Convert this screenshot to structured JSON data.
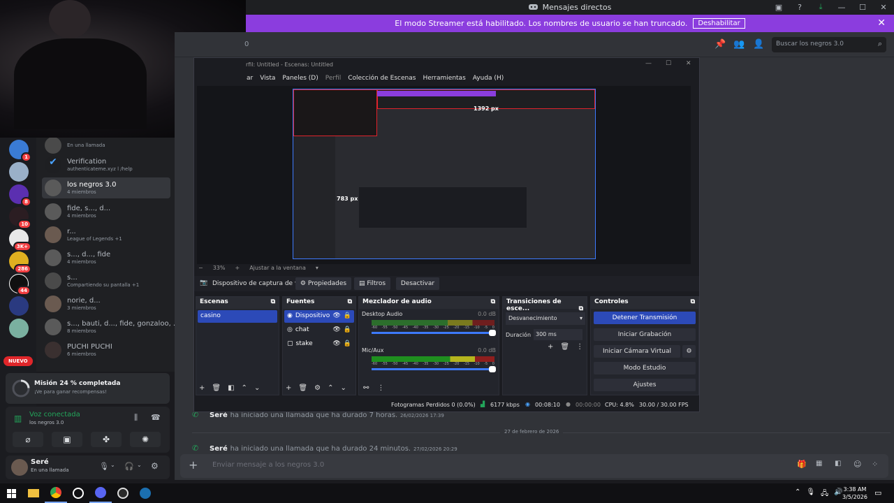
{
  "topbar": {
    "title": "Mensajes directos"
  },
  "streamer_banner": {
    "text": "El modo Streamer está habilitado. Los nombres de usuario se han truncado.",
    "button": "Deshabilitar"
  },
  "chat_header": {
    "search_placeholder": "Buscar los negros 3.0"
  },
  "server_badges": [
    "1",
    "8",
    "10",
    "3K+",
    "286",
    "44"
  ],
  "nuevo": "NUEVO",
  "dm_list": [
    {
      "name": "",
      "status": "En una llamada"
    },
    {
      "name": "Verification",
      "status": "authenticateme.xyz l /help"
    },
    {
      "name": "los negros 3.0",
      "status": "4 miembros"
    },
    {
      "name": "fide, s..., d...",
      "status": "4 miembros"
    },
    {
      "name": "r...",
      "status": "League of Legends +1"
    },
    {
      "name": "s..., d..., fide",
      "status": "4 miembros"
    },
    {
      "name": "s...",
      "status": "Compartiendo su pantalla +1"
    },
    {
      "name": "norie, d...",
      "status": "3 miembros"
    },
    {
      "name": "s..., bauti, d..., fide, gonzaloo, ...",
      "status": "8 miembros"
    },
    {
      "name": "PUCHI PUCHI",
      "status": "6 miembros"
    }
  ],
  "mission": {
    "title": "Misión 24 % completada",
    "sub": "¡Ve para ganar recompensas!",
    "progress": 0.24
  },
  "voice": {
    "status": "Voz conectada",
    "channel": "los negros 3.0"
  },
  "user": {
    "name": "Seré",
    "status": "En una llamada"
  },
  "obs": {
    "title": "rfil: Untitled - Escenas: Untitled",
    "menu": [
      "ar",
      "Vista",
      "Paneles (D)",
      "Perfil",
      "Colección de Escenas",
      "Herramientas",
      "Ayuda (H)"
    ],
    "dims": {
      "w": "1392 px",
      "h": "783 px"
    },
    "zoom": "33%",
    "fit": "Ajustar a la ventana",
    "source_bar": {
      "name": "Dispositivo de captura de v",
      "props": "Propiedades",
      "filters": "Filtros",
      "deactivate": "Desactivar"
    },
    "scenes_title": "Escenas",
    "scenes": [
      "casino"
    ],
    "sources_title": "Fuentes",
    "sources": [
      "Dispositivo",
      "chat",
      "stake"
    ],
    "mixer_title": "Mezclador de audio",
    "mixer": [
      {
        "name": "Desktop Audio",
        "db": "0.0 dB"
      },
      {
        "name": "Mic/Aux",
        "db": "0.0 dB"
      }
    ],
    "mixer_ticks": [
      "-60",
      "-55",
      "-50",
      "-45",
      "-40",
      "-35",
      "-30",
      "-25",
      "-20",
      "-15",
      "-10",
      "-5",
      "0"
    ],
    "transitions_title": "Transiciones de esce...",
    "transition": "Desvanecimiento",
    "duration_label": "Duración",
    "duration": "300 ms",
    "controls_title": "Controles",
    "controls": [
      "Detener Transmisión",
      "Iniciar Grabación",
      "Iniciar Cámara Virtual",
      "Modo Estudio",
      "Ajustes"
    ],
    "status": {
      "dropped": "Fotogramas Perdidos 0 (0.0%)",
      "kbps": "6177 kbps",
      "stream_time": "00:08:10",
      "rec_time": "00:00:00",
      "cpu": "CPU: 4.8%",
      "fps": "30.00 / 30.00 FPS"
    }
  },
  "messages": [
    {
      "author": "Seré",
      "text": "ha iniciado una llamada que ha durado 7 horas.",
      "date": "26/02/2026 17:39"
    },
    {
      "author": "Seré",
      "text": "ha iniciado una llamada que ha durado 24 minutos.",
      "date": "27/02/2026 20:29"
    }
  ],
  "date_divider": "27 de febrero de 2026",
  "composer": {
    "placeholder": "Enviar mensaje a los negros 3.0"
  },
  "taskbar": {
    "time": "3:38 AM",
    "date": "3/5/2026"
  },
  "colors": {
    "accent": "#5865f2",
    "streamer": "#8b3dde",
    "obs_active": "#2c4ab8",
    "green": "#23a55a",
    "red_badge": "#f23f42"
  }
}
